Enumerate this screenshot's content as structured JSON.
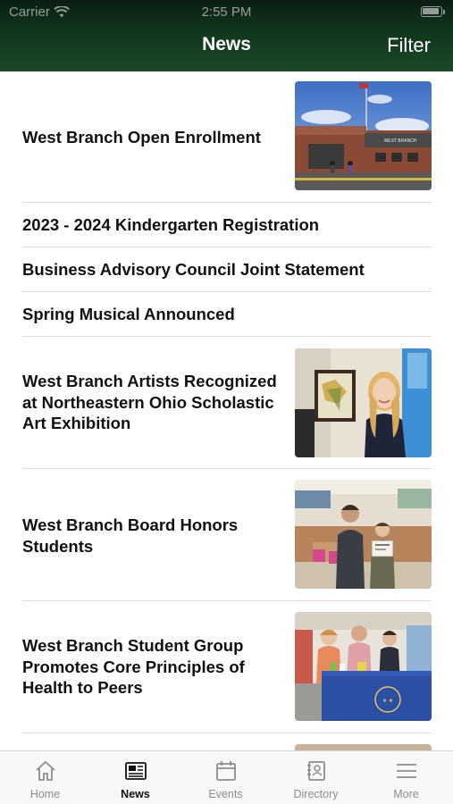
{
  "status_bar": {
    "carrier": "Carrier",
    "time": "2:55 PM"
  },
  "nav": {
    "title": "News",
    "filter_label": "Filter"
  },
  "news": [
    {
      "title": "West Branch Open Enrollment",
      "has_image": true,
      "image": "school-building"
    },
    {
      "title": "2023 - 2024 Kindergarten Registration",
      "has_image": false
    },
    {
      "title": "Business Advisory Council Joint Statement",
      "has_image": false
    },
    {
      "title": "Spring Musical Announced",
      "has_image": false
    },
    {
      "title": "West Branch Artists Recognized at Northeastern Ohio Scholastic Art Exhibition",
      "has_image": true,
      "image": "student-with-artwork"
    },
    {
      "title": "West Branch Board Honors Students",
      "has_image": true,
      "image": "student-with-certificate"
    },
    {
      "title": "West Branch Student Group Promotes Core Principles of Health to Peers",
      "has_image": true,
      "image": "students-at-table"
    }
  ],
  "tabs": [
    {
      "label": "Home",
      "icon": "home-icon",
      "active": false
    },
    {
      "label": "News",
      "icon": "newspaper-icon",
      "active": true
    },
    {
      "label": "Events",
      "icon": "calendar-icon",
      "active": false
    },
    {
      "label": "Directory",
      "icon": "contact-book-icon",
      "active": false
    },
    {
      "label": "More",
      "icon": "menu-icon",
      "active": false
    }
  ],
  "colors": {
    "header_dark": "#0b1f12",
    "header_green": "#1b4a29",
    "tab_active": "#111111",
    "tab_inactive": "#8c8c8c"
  }
}
